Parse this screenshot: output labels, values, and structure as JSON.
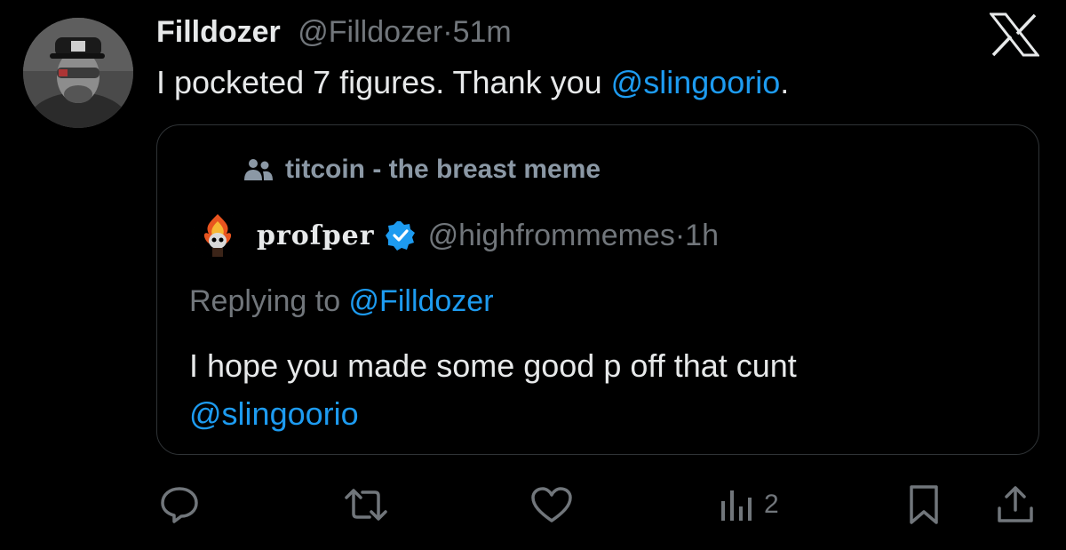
{
  "post": {
    "author_name": "Filldozer",
    "handle": "@Filldozer",
    "separator": "·",
    "time": "51m",
    "text_before": "I pocketed 7 figures. Thank you ",
    "mention": "@slingoorio",
    "text_after": ".",
    "avatar_icon": "profile-photo"
  },
  "brand": {
    "logo": "x-logo-icon"
  },
  "quote": {
    "community": "titcoin - the breast meme",
    "community_icon": "community-icon",
    "author_name": "pro𝔰per",
    "author_display": "proſper",
    "verified_icon": "verified-badge-icon",
    "handle": "@highfrommemes",
    "separator": "·",
    "time": "1h",
    "replying_label": "Replying to ",
    "replying_to": "@Filldozer",
    "text": "I hope you made some good p off that cunt",
    "mention": "@slingoorio"
  },
  "actions": {
    "reply_icon": "reply-icon",
    "repost_icon": "repost-icon",
    "like_icon": "heart-icon",
    "views_icon": "views-icon",
    "views_count": "2",
    "bookmark_icon": "bookmark-icon",
    "share_icon": "share-icon"
  },
  "colors": {
    "background": "#000000",
    "text": "#e7e9ea",
    "muted": "#71767b",
    "link": "#1d9bf0",
    "verified": "#1d9bf0",
    "border": "#2f3336"
  }
}
